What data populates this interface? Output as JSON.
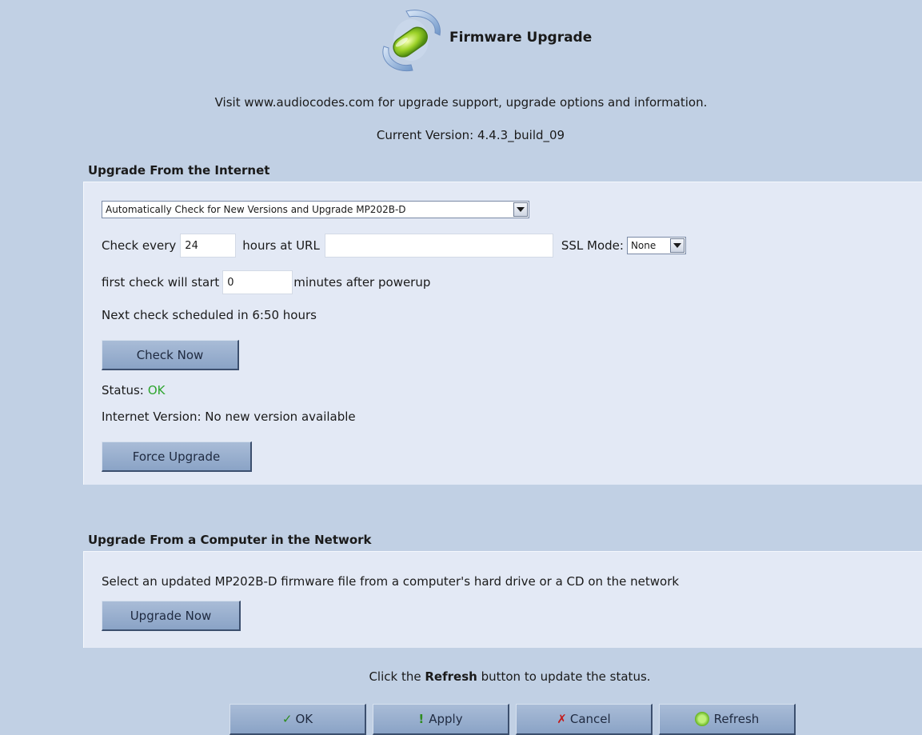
{
  "header": {
    "title": "Firmware Upgrade",
    "icon": "firmware-upgrade-icon"
  },
  "info": {
    "support_text": "Visit www.audiocodes.com for upgrade support, upgrade options and information.",
    "current_version": "Current Version: 4.4.3_build_09"
  },
  "internet": {
    "section_title": "Upgrade From the Internet",
    "mode_select": "Automatically Check for New Versions and Upgrade MP202B-D",
    "check_every_label": "Check every",
    "check_every_value": "24",
    "hours_at_url_label": "hours at URL",
    "url_value": "",
    "ssl_mode_label": "SSL Mode:",
    "ssl_mode_value": "None",
    "first_check_label": "first check will start",
    "first_check_value": "0",
    "minutes_label": "minutes after powerup",
    "next_check_text": "Next check scheduled in 6:50 hours",
    "check_now_label": "Check Now",
    "status_label": "Status:",
    "status_value": "OK",
    "internet_version_text": "Internet Version: No new version available",
    "force_upgrade_label": "Force Upgrade"
  },
  "network": {
    "section_title": "Upgrade From a Computer in the Network",
    "description": "Select an updated MP202B-D firmware file from a computer's hard drive or a CD on the network",
    "upgrade_now_label": "Upgrade Now"
  },
  "footer": {
    "refresh_hint_prefix": "Click the",
    "refresh_hint_bold": "Refresh",
    "refresh_hint_suffix": "button to update the status.",
    "ok_label": "OK",
    "apply_label": "Apply",
    "cancel_label": "Cancel",
    "refresh_label": "Refresh"
  },
  "colors": {
    "background": "#c1d0e4",
    "panel": "#e3e9f5",
    "status_ok": "#2ea52e",
    "button": "#9bb1d0"
  }
}
